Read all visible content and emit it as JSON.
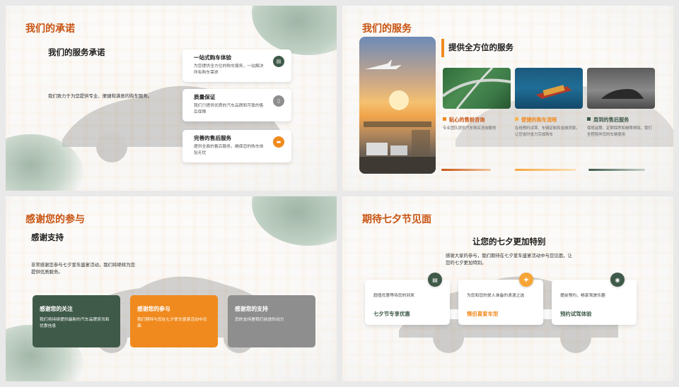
{
  "colors": {
    "orange": "#f08a1e",
    "title": "#c85412",
    "green": "#3f5a49",
    "gray": "#8e8e8e"
  },
  "slide1": {
    "title": "我们的承诺",
    "subtitle": "我们的服务承诺",
    "body": "我们致力于为您提供专业、便捷和满意的购车服务。",
    "cards": [
      {
        "title": "一站式购车体验",
        "desc": "为您提供全方位的购车服务，一站解决所有购车需求",
        "icon": "wallet-icon"
      },
      {
        "title": "质量保证",
        "desc": "我们只提供优质的汽车品牌和可靠的售后保障",
        "icon": "document-icon"
      },
      {
        "title": "完善的售后服务",
        "desc": "提供全面的售后服务，确保您的购车体验无忧",
        "icon": "chat-icon"
      }
    ]
  },
  "slide2": {
    "title": "我们的服务",
    "subtitle": "提供全方位的服务",
    "features": [
      {
        "title": "贴心的售前咨询",
        "desc": "专业团队提供汽车购买咨询服务"
      },
      {
        "title": "便捷的购车流程",
        "desc": "在线预约试驾、车辆定制和金融贷款，让您省时省力完成购车"
      },
      {
        "title": "周到的售后服务",
        "desc": "保修延期、定期保养和故障排除，我们全程陪伴您的车辆使用"
      }
    ]
  },
  "slide3": {
    "title": "感谢您的参与",
    "subtitle": "感谢支持",
    "body": "非常感谢您参与七夕爱车盛宴活动，我们将继续为您提供优质服务。",
    "boxes": [
      {
        "title": "感谢您的关注",
        "desc": "我们将持续提供最新的汽车品牌资讯和优惠信息"
      },
      {
        "title": "感谢您的参与",
        "desc": "我们期待与您在七夕爱车盛宴活动中见面"
      },
      {
        "title": "感谢您的支持",
        "desc": "您的支持是我们前进的动力"
      }
    ]
  },
  "slide4": {
    "title": "期待七夕节见面",
    "subtitle": "让您的七夕更加特别",
    "body": "感谢大家的参与，我们期待在七夕爱车盛宴活动中与您见面，让您的七夕更加特别。",
    "cards": [
      {
        "desc": "超值优惠等待您的到来",
        "title": "七夕节专享优惠",
        "icon": "wallet-icon"
      },
      {
        "desc": "为您和您的爱人准备的浪漫之选",
        "title": "情侣喜爱车型",
        "icon": "plus-icon"
      },
      {
        "desc": "提前预约，畅享驾驶乐趣",
        "title": "预约试驾体验",
        "icon": "steering-icon"
      }
    ]
  }
}
